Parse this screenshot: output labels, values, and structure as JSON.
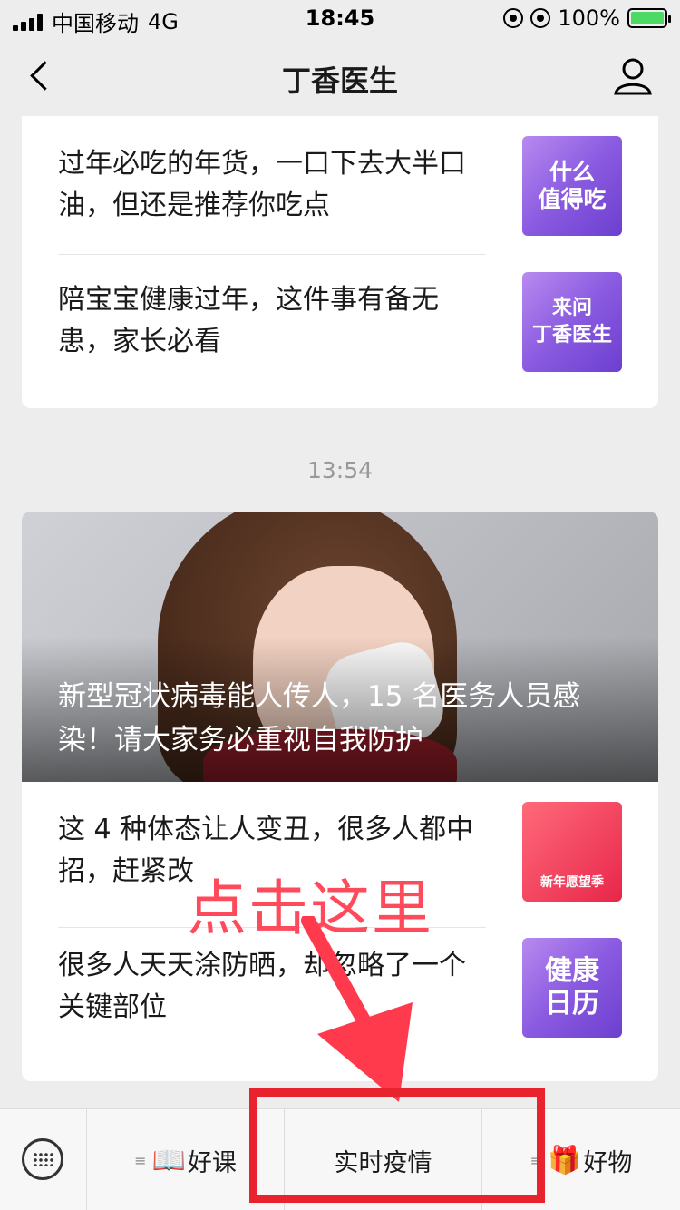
{
  "status_bar": {
    "carrier": "中国移动",
    "network": "4G",
    "time": "18:45",
    "battery": "100%",
    "battery_level": 1.0
  },
  "nav": {
    "title": "丁香医生"
  },
  "card1": {
    "items": [
      {
        "title": "过年必吃的年货，一口下去大半口油，但还是推荐你吃点",
        "thumb_text": "什么\n值得吃"
      },
      {
        "title": "陪宝宝健康过年，这件事有备无患，家长必看",
        "thumb_text": "来问\n丁香医生"
      }
    ]
  },
  "timestamp": "13:54",
  "card2": {
    "cover_title": "新型冠状病毒能人传人，15 名医务人员感染！请大家务必重视自我防护",
    "items": [
      {
        "title": "这 4 种体态让人变丑，很多人都中招，赶紧改",
        "thumb_text": "新年愿望季"
      },
      {
        "title": "很多人天天涂防晒，却忽略了一个关键部位",
        "thumb_text": "健康\n日历"
      }
    ]
  },
  "annotation": {
    "text": "点击这里",
    "color": "#ff4a5c",
    "box_color": "#e8232e"
  },
  "bottom_menu": {
    "items": [
      {
        "icon": "book-icon",
        "emoji": "📖",
        "label": "好课"
      },
      {
        "label": "实时疫情"
      },
      {
        "icon": "gift-icon",
        "emoji": "🎁",
        "label": "好物"
      }
    ]
  }
}
